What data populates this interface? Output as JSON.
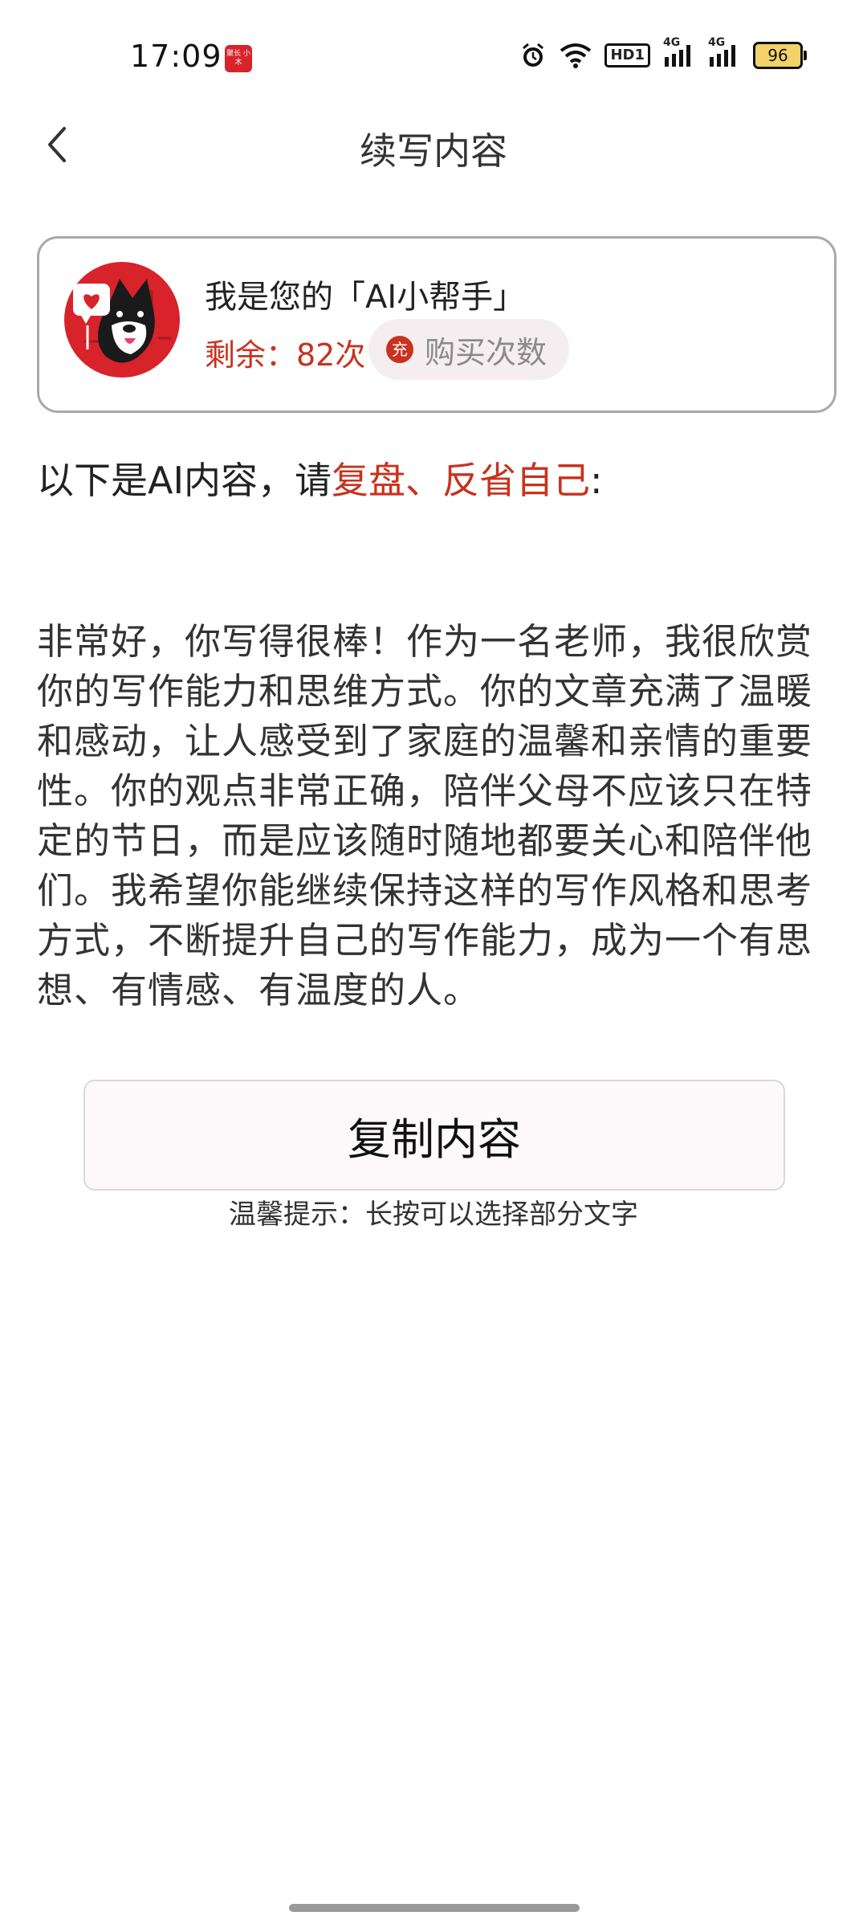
{
  "status_bar": {
    "time": "17:09",
    "app_badge": "聚长\n小木",
    "hd_label": "HD1",
    "net1": "4G",
    "net2": "4G",
    "battery": "96"
  },
  "header": {
    "title": "续写内容"
  },
  "card": {
    "title": "我是您的「AI小帮手」",
    "remaining": "剩余：82次",
    "buy_icon": "充",
    "buy_label": "购买次数"
  },
  "prompt": {
    "prefix": "以下是AI内容，请",
    "highlight": "复盘、反省自己",
    "suffix": ":"
  },
  "content": {
    "text": "非常好，你写得很棒！作为一名老师，我很欣赏你的写作能力和思维方式。你的文章充满了温暖和感动，让人感受到了家庭的温馨和亲情的重要性。你的观点非常正确，陪伴父母不应该只在特定的节日，而是应该随时随地都要关心和陪伴他们。我希望你能继续保持这样的写作风格和思考方式，不断提升自己的写作能力，成为一个有思想、有情感、有温度的人。"
  },
  "actions": {
    "copy_label": "复制内容",
    "tip": "温馨提示：长按可以选择部分文字"
  },
  "colors": {
    "accent": "#c8321e",
    "battery": "#f2d36a"
  }
}
